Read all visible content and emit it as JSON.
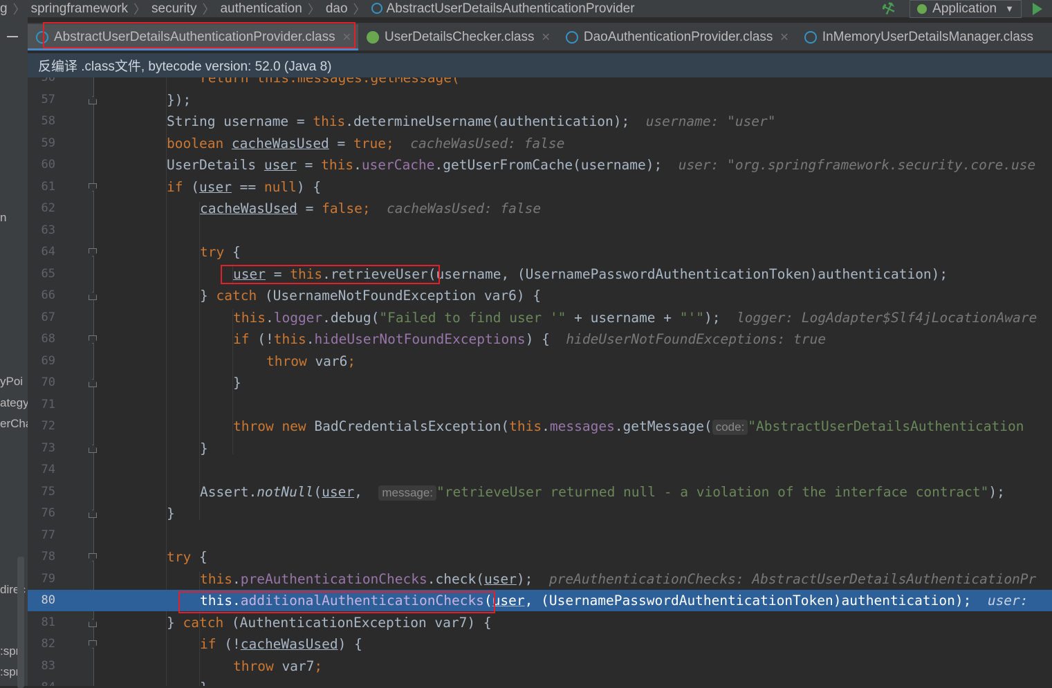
{
  "breadcrumb": {
    "items": [
      "g",
      "springframework",
      "security",
      "authentication",
      "dao",
      "AbstractUserDetailsAuthenticationProvider"
    ]
  },
  "toolbar": {
    "run_config": "Application"
  },
  "sidebar_fragments": [
    "n",
    "yPoi",
    "ategy",
    "erCha",
    "direc",
    ":spri",
    ":spri"
  ],
  "tabs": [
    {
      "label": "AbstractUserDetailsAuthenticationProvider.class",
      "active": true
    },
    {
      "label": "UserDetailsChecker.class",
      "active": false
    },
    {
      "label": "DaoAuthenticationProvider.class",
      "active": false
    },
    {
      "label": "InMemoryUserDetailsManager.class",
      "active": false
    }
  ],
  "banner": "反编译 .class文件, bytecode version: 52.0 (Java 8)",
  "code": {
    "line_numbers": [
      "56",
      "57",
      "58",
      "59",
      "60",
      "61",
      "62",
      "63",
      "64",
      "65",
      "66",
      "67",
      "68",
      "69",
      "70",
      "71",
      "72",
      "73",
      "74",
      "75",
      "76",
      "77",
      "78",
      "79",
      "80",
      "81",
      "82",
      "83",
      "84"
    ],
    "top_partial": "return this.messages.getMessage(",
    "l57": "});",
    "l58": {
      "a": "String username = ",
      "b": "this",
      "c": ".determineUsername(authentication);",
      "hint": "username: \"user\""
    },
    "l59": {
      "a": "boolean ",
      "b": "cacheWasUsed",
      "c": " = ",
      "d": "true",
      "e": ";",
      "hint": "cacheWasUsed: false"
    },
    "l60": {
      "a": "UserDetails ",
      "b": "user",
      "c": " = ",
      "d": "this",
      "e": ".",
      "f": "userCache",
      "g": ".getUserFromCache(username);",
      "hint": "user: \"org.springframework.security.core.use"
    },
    "l61": {
      "a": "if",
      "b": " (",
      "c": "user",
      "d": " == ",
      "e": "null",
      "f": ") {"
    },
    "l62": {
      "a": "cacheWasUsed",
      "b": " = ",
      "c": "false",
      "d": ";",
      "hint": "cacheWasUsed: false"
    },
    "l64": {
      "a": "try",
      "b": " {"
    },
    "l65": {
      "a": "user",
      "b": " = ",
      "c": "this",
      "d": ".retrieveUser(username, (UsernamePasswordAuthenticationToken)authentication);"
    },
    "l66": {
      "a": "} ",
      "b": "catch",
      "c": " (UsernameNotFoundException var6) {"
    },
    "l67": {
      "a": "this",
      "b": ".",
      "c": "logger",
      "d": ".debug(",
      "e": "\"Failed to find user '\"",
      "f": " + username + ",
      "g": "\"'\"",
      "h": ");",
      "hint": "logger: LogAdapter$Slf4jLocationAware"
    },
    "l68": {
      "a": "if",
      "b": " (!",
      "c": "this",
      "d": ".",
      "e": "hideUserNotFoundExceptions",
      "f": ") {",
      "hint": "hideUserNotFoundExceptions: true"
    },
    "l69": {
      "a": "throw",
      "b": " var6",
      "c": ";"
    },
    "l70": "}",
    "l72": {
      "a": "throw new",
      "b": " BadCredentialsException(",
      "c": "this",
      "d": ".",
      "e": "messages",
      "f": ".getMessage(",
      "param": "code:",
      "g": "\"AbstractUserDetailsAuthentication"
    },
    "l73": "}",
    "l75": {
      "a": "Assert.",
      "b": "notNull",
      "c": "(",
      "d": "user",
      "e": ", ",
      "param": "message:",
      "f": "\"retrieveUser returned null - a violation of the interface contract\"",
      "g": ");"
    },
    "l76": "}",
    "l78": {
      "a": "try",
      "b": " {"
    },
    "l79": {
      "a": "this",
      "b": ".",
      "c": "preAuthenticationChecks",
      "d": ".check(",
      "e": "user",
      "f": ");",
      "hint": "preAuthenticationChecks: AbstractUserDetailsAuthenticationPr"
    },
    "l80": {
      "a": "this",
      "b": ".",
      "c": "additionalAuthenticationChecks",
      "d": "(",
      "e": "user",
      "f": ", (UsernamePasswordAuthenticationToken)authentication);",
      "hint": "user: "
    },
    "l81": {
      "a": "} ",
      "b": "catch",
      "c": " (AuthenticationException var7) {"
    },
    "l82": {
      "a": "if",
      "b": " (!",
      "c": "cacheWasUsed",
      "d": ") {"
    },
    "l83": {
      "a": "throw",
      "b": " var7",
      "c": ";"
    },
    "l84": "}"
  }
}
